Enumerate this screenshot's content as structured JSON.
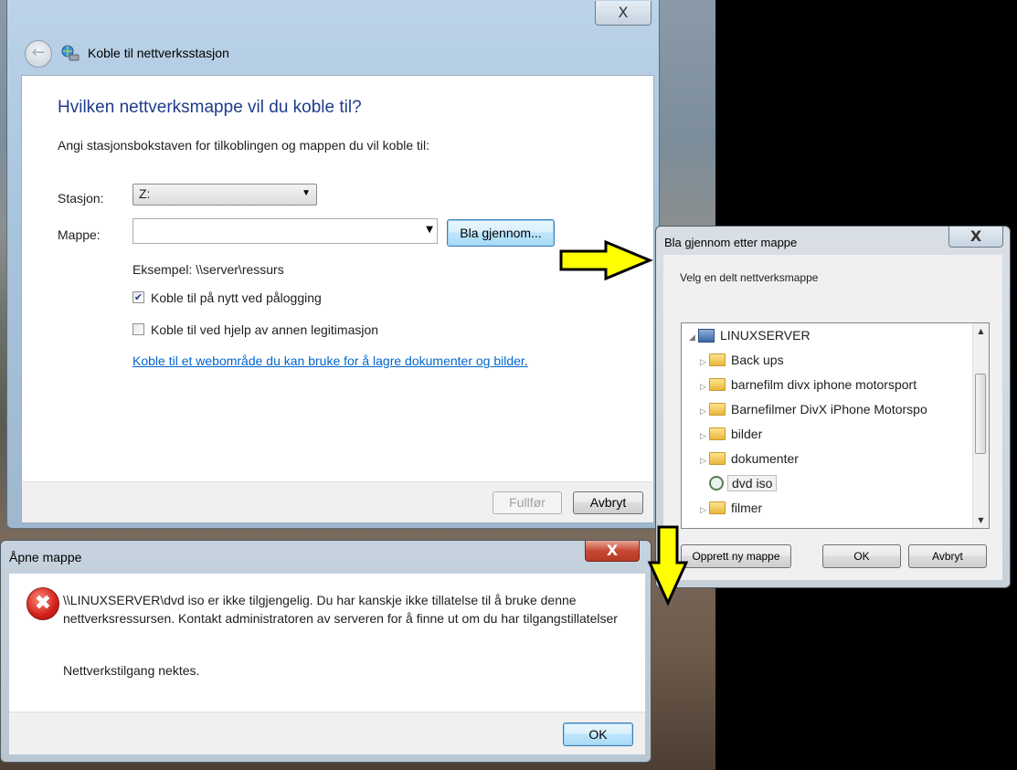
{
  "wizard": {
    "title": "Koble til nettverksstasjon",
    "heading": "Hvilken nettverksmappe vil du koble til?",
    "instruction": "Angi stasjonsbokstaven for tilkoblingen og mappen du vil koble til:",
    "drive_label": "Stasjon:",
    "drive_value": "Z:",
    "folder_label": "Mappe:",
    "folder_value": "",
    "browse_button": "Bla gjennom...",
    "example": "Eksempel: \\\\server\\ressurs",
    "reconnect_label": "Koble til på nytt ved pålogging",
    "reconnect_checked": true,
    "other_credentials_label": "Koble til ved hjelp av annen legitimasjon",
    "other_credentials_checked": false,
    "website_link": "Koble til et webområde du kan bruke for å lagre dokumenter og bilder",
    "finish_button": "Fullfør",
    "cancel_button": "Avbryt",
    "close_glyph": "X"
  },
  "browse_dialog": {
    "title": "Bla gjennom etter mappe",
    "description": "Velg en delt nettverksmappe",
    "tree": {
      "root": "LINUXSERVER",
      "items": [
        {
          "label": "Back ups",
          "icon": "folder-icon",
          "selected": false
        },
        {
          "label": "barnefilm divx iphone motorsport",
          "icon": "folder-icon",
          "selected": false
        },
        {
          "label": "Barnefilmer DivX iPhone Motorspo",
          "icon": "folder-icon",
          "selected": false
        },
        {
          "label": "bilder",
          "icon": "folder-icon",
          "selected": false
        },
        {
          "label": "dokumenter",
          "icon": "folder-icon",
          "selected": false
        },
        {
          "label": "dvd iso",
          "icon": "network-search-icon",
          "selected": true
        },
        {
          "label": "filmer",
          "icon": "folder-icon",
          "selected": false
        }
      ]
    },
    "new_folder_button": "Opprett ny mappe",
    "ok_button": "OK",
    "cancel_button": "Avbryt",
    "close_glyph": "X"
  },
  "error_dialog": {
    "title": "Åpne mappe",
    "message": "\\\\LINUXSERVER\\dvd iso er ikke tilgjengelig. Du har kanskje ikke tillatelse til å bruke denne nettverksressursen. Kontakt administratoren av serveren for å finne ut om du har tilgangstillatelser",
    "detail": "Nettverkstilgang nektes.",
    "ok_button": "OK",
    "close_glyph": "X"
  },
  "colors": {
    "heading": "#1e3c8c",
    "link": "#0066cc",
    "annotation_arrow": "#ffff00",
    "error_close": "#c74a34"
  }
}
